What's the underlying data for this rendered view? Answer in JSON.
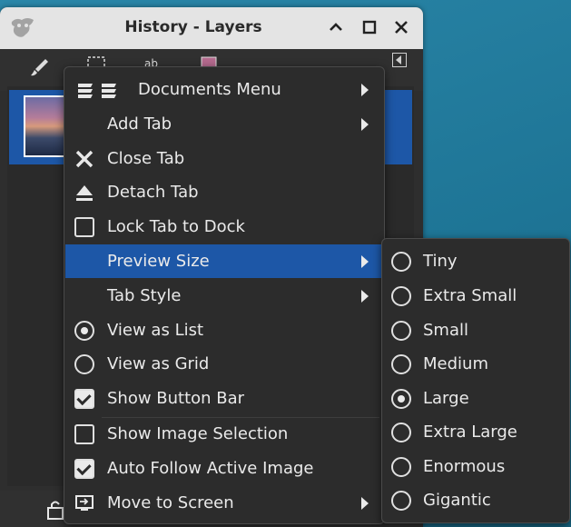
{
  "window": {
    "title": "History - Layers",
    "buttons": {
      "minimize": "^",
      "maximize": "□",
      "close": "✕"
    }
  },
  "colors": {
    "accent": "#1d57a7",
    "menu_bg": "#2c2c2c",
    "desktop": "#1b7d9c"
  },
  "tab_icons": [
    "brush-icon",
    "selection-icon",
    "text-icon",
    "image-icon"
  ],
  "menu": {
    "items": [
      {
        "label": "Documents Menu",
        "icon": "documents-icon",
        "submenu": true
      },
      {
        "label": "Add Tab",
        "submenu": true
      },
      {
        "label": "Close Tab",
        "icon": "close-icon"
      },
      {
        "label": "Detach Tab",
        "icon": "eject-icon"
      },
      {
        "label": "Lock Tab to Dock",
        "check": "off"
      },
      {
        "label": "Preview Size",
        "submenu": true,
        "highlighted": true
      },
      {
        "label": "Tab Style",
        "submenu": true
      },
      {
        "label": "View as List",
        "radio": "on"
      },
      {
        "label": "View as Grid",
        "radio": "off"
      },
      {
        "label": "Show Button Bar",
        "check": "on"
      },
      {
        "label": "Show Image Selection",
        "check": "off"
      },
      {
        "label": "Auto Follow Active Image",
        "check": "on"
      },
      {
        "label": "Move to Screen",
        "icon": "screen-icon",
        "submenu": true
      }
    ]
  },
  "preview_size_menu": {
    "items": [
      {
        "label": "Tiny",
        "selected": false
      },
      {
        "label": "Extra Small",
        "selected": false
      },
      {
        "label": "Small",
        "selected": false
      },
      {
        "label": "Medium",
        "selected": false
      },
      {
        "label": "Large",
        "selected": true
      },
      {
        "label": "Extra Large",
        "selected": false
      },
      {
        "label": "Enormous",
        "selected": false
      },
      {
        "label": "Gigantic",
        "selected": false
      }
    ]
  }
}
